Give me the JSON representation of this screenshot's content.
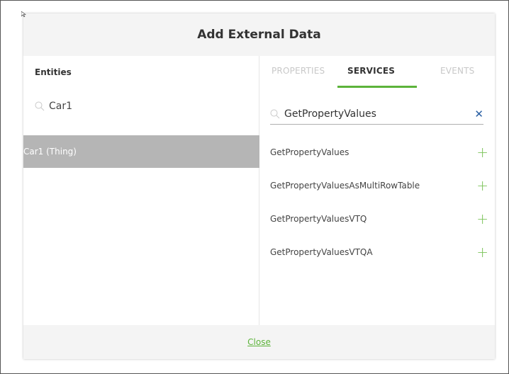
{
  "dialog": {
    "title": "Add External Data",
    "close_label": "Close"
  },
  "entities": {
    "label": "Entities",
    "search_value": "Car1",
    "items": [
      {
        "label": "Car1 (Thing)",
        "selected": true
      }
    ]
  },
  "tabs": [
    {
      "label": "PROPERTIES",
      "active": false
    },
    {
      "label": "SERVICES",
      "active": true
    },
    {
      "label": "EVENTS",
      "active": false
    }
  ],
  "services": {
    "search_value": "GetPropertyValues",
    "clear_icon": "close-icon",
    "items": [
      {
        "label": "GetPropertyValues",
        "action_icon": "plus-icon"
      },
      {
        "label": "GetPropertyValuesAsMultiRowTable",
        "action_icon": "plus-icon"
      },
      {
        "label": "GetPropertyValuesVTQ",
        "action_icon": "plus-icon"
      },
      {
        "label": "GetPropertyValuesVTQA",
        "action_icon": "plus-icon"
      }
    ]
  },
  "colors": {
    "accent": "#5cb33a",
    "plus": "#7cc35a",
    "selected_row": "#b5b5b5",
    "clear_icon": "#2a5fa3"
  }
}
